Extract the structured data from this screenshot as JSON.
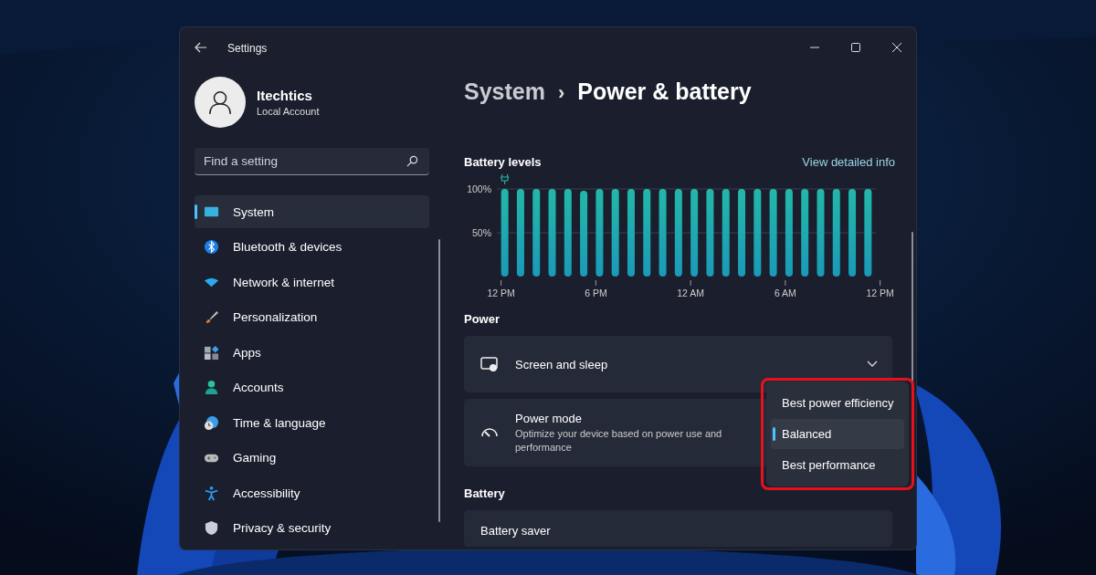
{
  "window": {
    "title": "Settings"
  },
  "account": {
    "name": "Itechtics",
    "type": "Local Account"
  },
  "search": {
    "placeholder": "Find a setting"
  },
  "sidebar": {
    "items": [
      {
        "label": "System",
        "selected": true
      },
      {
        "label": "Bluetooth & devices",
        "selected": false
      },
      {
        "label": "Network & internet",
        "selected": false
      },
      {
        "label": "Personalization",
        "selected": false
      },
      {
        "label": "Apps",
        "selected": false
      },
      {
        "label": "Accounts",
        "selected": false
      },
      {
        "label": "Time & language",
        "selected": false
      },
      {
        "label": "Gaming",
        "selected": false
      },
      {
        "label": "Accessibility",
        "selected": false
      },
      {
        "label": "Privacy & security",
        "selected": false
      }
    ]
  },
  "breadcrumb": {
    "parent": "System",
    "separator": "›",
    "current": "Power & battery"
  },
  "battery_levels": {
    "title": "Battery levels",
    "link": "View detailed info",
    "chart_data": {
      "type": "bar",
      "categories": [
        "12 PM",
        null,
        null,
        null,
        null,
        null,
        "6 PM",
        null,
        null,
        null,
        null,
        null,
        "12 AM",
        null,
        null,
        null,
        null,
        null,
        "6 AM",
        null,
        null,
        null,
        null,
        null,
        "12 PM"
      ],
      "values": [
        100,
        100,
        100,
        100,
        100,
        98,
        100,
        100,
        100,
        100,
        100,
        100,
        100,
        100,
        100,
        100,
        100,
        100,
        100,
        100,
        100,
        100,
        100,
        100,
        null
      ],
      "ylim": [
        0,
        100
      ],
      "yticks": [
        {
          "value": 50,
          "label": "50%"
        },
        {
          "value": 100,
          "label": "100%"
        }
      ]
    }
  },
  "power": {
    "heading": "Power",
    "settings": [
      {
        "kind": "expander",
        "title": "Screen and sleep"
      },
      {
        "kind": "dropdown",
        "title": "Power mode",
        "description": "Optimize your device based on power use and performance",
        "options": [
          {
            "label": "Best power efficiency",
            "selected": false
          },
          {
            "label": "Balanced",
            "selected": true
          },
          {
            "label": "Best performance",
            "selected": false
          }
        ]
      }
    ]
  },
  "battery": {
    "heading": "Battery",
    "settings": [
      {
        "kind": "expander",
        "title": "Battery saver"
      }
    ]
  }
}
